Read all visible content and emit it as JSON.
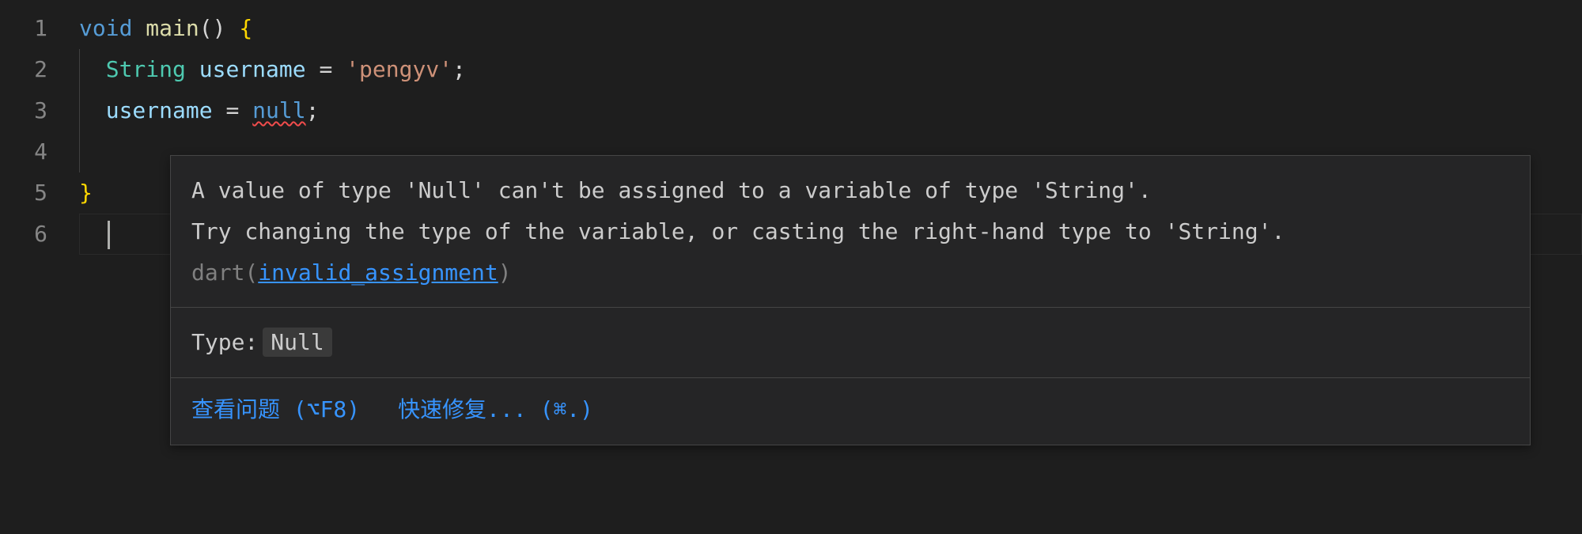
{
  "gutter": {
    "lines": [
      "1",
      "2",
      "3",
      "4",
      "5",
      "6"
    ]
  },
  "code": {
    "l1": {
      "kw_void": "void",
      "fn_main": "main",
      "parens": "()",
      "brace_open": "{"
    },
    "l2": {
      "ty_string": "String",
      "var_username": "username",
      "eq": "=",
      "str": "'pengyv'",
      "semi": ";"
    },
    "l3": {
      "var_username": "username",
      "eq": "=",
      "kw_null": "null",
      "semi": ";"
    },
    "l5": {
      "brace_close": "}"
    }
  },
  "hover": {
    "message": "A value of type 'Null' can't be assigned to a variable of type 'String'.\nTry changing the type of the variable, or casting the right-hand type to 'String'.",
    "source_prefix": " dart(",
    "error_code": "invalid_assignment",
    "source_suffix": ")",
    "type_label": "Type:",
    "type_value": "Null",
    "action_view": "查看问题 (⌥F8)",
    "action_fix": "快速修复... (⌘.)"
  }
}
